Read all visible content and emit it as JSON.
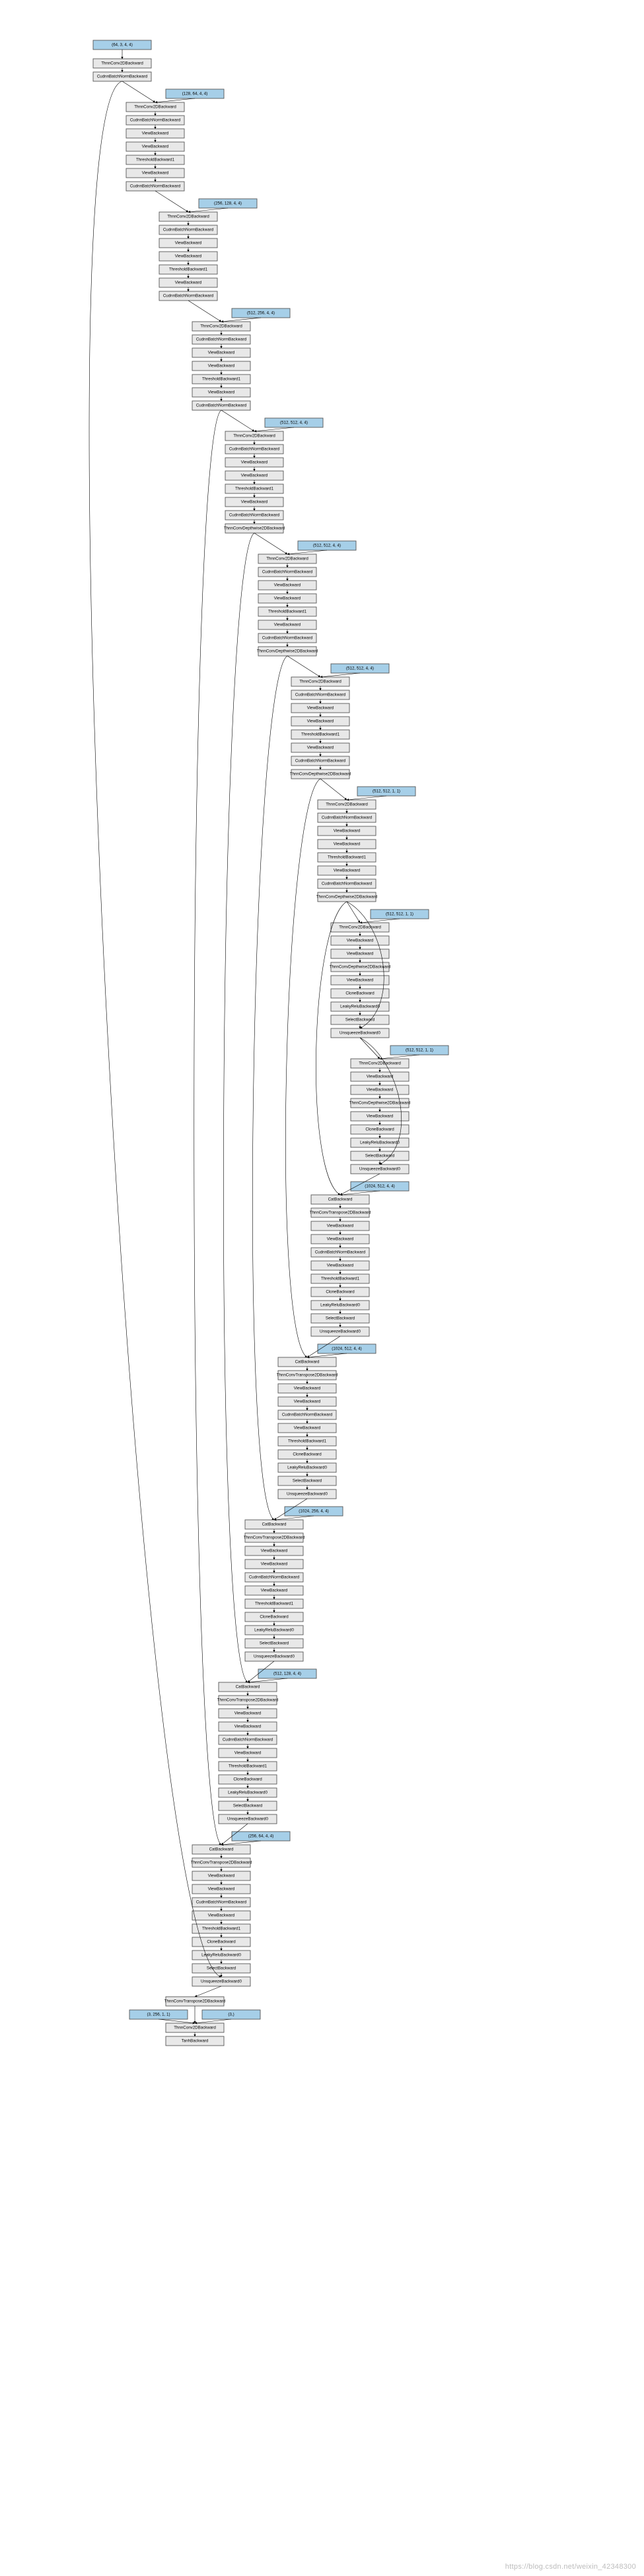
{
  "watermark": "https://blog.csdn.net/weixin_42348300",
  "blockSeq": [
    "ThnnConv2DBackward",
    "CudnnBatchNormBackward",
    "ViewBackward",
    "ViewBackward",
    "ThresholdBackward1",
    "ViewBackward",
    "CudnnBatchNormBackward"
  ],
  "blockSeqDepthwise": [
    "ThnnConv2DBackward",
    "CudnnBatchNormBackward",
    "ViewBackward",
    "ViewBackward",
    "ThresholdBackward1",
    "ViewBackward",
    "CudnnBatchNormBackward",
    "ThnnConvDepthwise2DBackward"
  ],
  "tail": [
    "CatBackward",
    "ThnnConvTranspose2DBackward",
    "ViewBackward",
    "ViewBackward",
    "CudnnBatchNormBackward",
    "ViewBackward",
    "ThresholdBackward1",
    "CloneBackward",
    "LeakyReluBackward0",
    "SelectBackward",
    "UnsqueezeBackward0"
  ],
  "residualSeq": [
    "ThnnConv2DBackward",
    "ViewBackward",
    "ViewBackward",
    "ThnnConvDepthwise2DBackward",
    "ViewBackward",
    "CloneBackward",
    "LeakyReluBackward0",
    "SelectBackward",
    "UnsqueezeBackward0"
  ],
  "chart_data": {
    "type": "diagram",
    "description": "PyTorch autograd backward graph (computation graph) rendered as a flowchart. Blue boxes are AccumulateGrad / parameter tensors (with shape), grey boxes are backward function nodes. Arrows denote gradient flow (top to bottom).",
    "nodes": {
      "root_param": {
        "kind": "param",
        "label": "(64, 3, 4, 4)"
      },
      "root_conv": {
        "kind": "op",
        "label": "ThnnConv2DBackward"
      },
      "root_bn": {
        "kind": "op",
        "label": "CudnnBatchNormBackward"
      },
      "p_b0": {
        "kind": "param",
        "label": "(128, 64, 4, 4)"
      },
      "p_b1": {
        "kind": "param",
        "label": "(256, 128, 4, 4)"
      },
      "p_b2": {
        "kind": "param",
        "label": "(512, 256, 4, 4)"
      },
      "p_b3": {
        "kind": "param",
        "label": "(512, 512, 4, 4)"
      },
      "p_b4": {
        "kind": "param",
        "label": "(512, 512, 4, 4)"
      },
      "p_b5": {
        "kind": "param",
        "label": "(512, 512, 4, 4)"
      },
      "p_b6": {
        "kind": "param",
        "label": "(512, 512, 1, 1)"
      },
      "p_r0": {
        "kind": "param",
        "label": "(512, 512, 1, 1)"
      },
      "p_r1": {
        "kind": "param",
        "label": "(512, 512, 1, 1)"
      },
      "p_t0": {
        "kind": "param",
        "label": "(1024, 512, 4, 4)"
      },
      "p_t1": {
        "kind": "param",
        "label": "(1024, 512, 4, 4)"
      },
      "p_t2": {
        "kind": "param",
        "label": "(1024, 256, 4, 4)"
      },
      "p_t3": {
        "kind": "param",
        "label": "(512, 128, 4, 4)"
      },
      "p_t4": {
        "kind": "param",
        "label": "(256, 64, 4, 4)"
      },
      "out_transpose": {
        "kind": "op",
        "label": "ThnnConvTranspose2DBackward"
      },
      "out_p_w": {
        "kind": "param",
        "label": "(3, 256, 1, 1)"
      },
      "out_p_b": {
        "kind": "param",
        "label": "(3,)"
      },
      "out_conv": {
        "kind": "op",
        "label": "ThnnConv2DBackward"
      },
      "out_tanh": {
        "kind": "op",
        "label": "TanhBackward"
      }
    }
  }
}
